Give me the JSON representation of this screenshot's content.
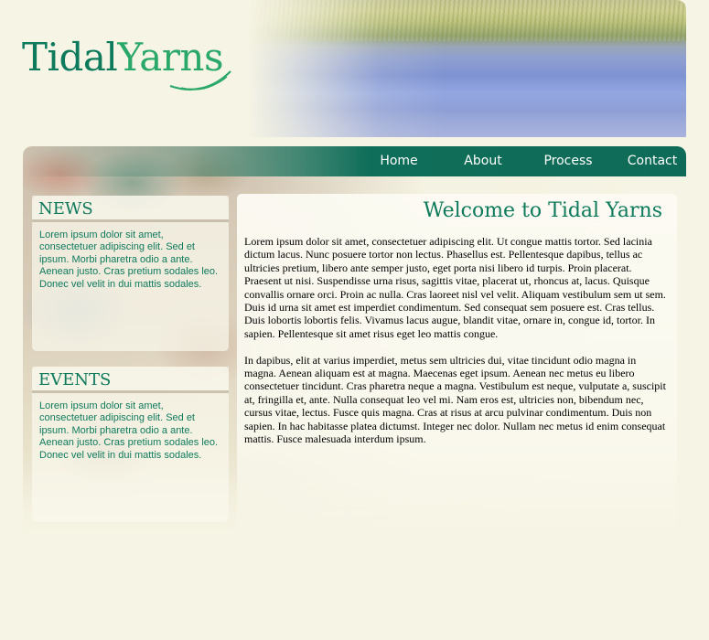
{
  "logo": {
    "part1": "Tidal",
    "part2": "Yarns"
  },
  "nav": {
    "home": "Home",
    "about": "About",
    "process": "Process",
    "contact": "Contact"
  },
  "news": {
    "title": "NEWS",
    "body": "Lorem ipsum dolor sit amet, consectetuer adipiscing elit. Sed et ipsum. Morbi pharetra odio a ante. Aenean justo. Cras pretium sodales leo. Donec vel velit in dui mattis sodales."
  },
  "events": {
    "title": "EVENTS",
    "body": "Lorem ipsum dolor sit amet, consectetuer adipiscing elit. Sed et ipsum. Morbi pharetra odio a ante. Aenean justo. Cras pretium sodales leo. Donec vel velit in dui mattis sodales."
  },
  "main": {
    "title": "Welcome to Tidal Yarns",
    "paragraph1": "Lorem ipsum dolor sit amet, consectetuer adipiscing elit. Ut congue mattis tortor. Sed lacinia dictum lacus. Nunc posuere tortor non lectus. Phasellus est. Pellentesque dapibus, tellus ac ultricies pretium, libero ante semper justo, eget porta nisi libero id turpis. Proin placerat. Praesent ut nisi. Suspendisse urna risus, sagittis vitae, placerat ut, rhoncus at, lacus. Quisque convallis ornare orci. Proin ac nulla. Cras laoreet nisl vel velit. Aliquam vestibulum sem ut sem. Duis id urna sit amet est imperdiet condimentum. Sed consequat sem posuere est. Cras tellus. Duis lobortis lobortis felis. Vivamus lacus augue, blandit vitae, ornare in, congue id, tortor. In sapien. Pellentesque sit amet risus eget leo mattis congue.",
    "paragraph2": "In dapibus, elit at varius imperdiet, metus sem ultricies dui, vitae tincidunt odio magna in magna. Aenean aliquam est at magna. Maecenas eget ipsum. Aenean nec metus eu libero consectetuer tincidunt. Cras pharetra neque a magna. Vestibulum est neque, vulputate a, suscipit at, fringilla et, ante. Nulla consequat leo vel mi. Nam eros est, ultricies non, bibendum nec, cursus vitae, lectus. Fusce quis magna. Cras at risus at arcu pulvinar condimentum. Duis non sapien. In hac habitasse platea dictumst. Integer nec dolor. Nullam nec metus id enim consequat mattis. Fusce malesuada interdum ipsum."
  },
  "colors": {
    "brand_green": "#0e7a5c",
    "nav_green": "#0f6e59",
    "background": "#f6f4e4"
  },
  "icons": {
    "logo_swoosh": "yarn-swoosh-icon"
  }
}
